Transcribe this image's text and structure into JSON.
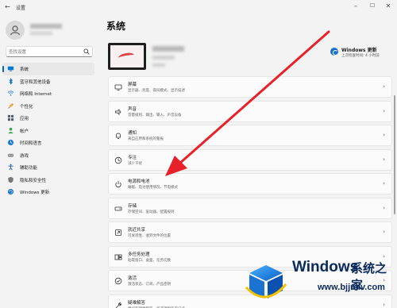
{
  "window": {
    "title": "设置"
  },
  "search": {
    "placeholder": "查找设置"
  },
  "nav": [
    {
      "label": "系统",
      "icon": "monitor-icon",
      "color": "#0078d4",
      "active": true
    },
    {
      "label": "蓝牙和其他设备",
      "icon": "bluetooth-icon",
      "color": "#0067c0"
    },
    {
      "label": "网络和 Internet",
      "icon": "wifi-icon",
      "color": "#3a86d9"
    },
    {
      "label": "个性化",
      "icon": "brush-icon",
      "color": "#e8a33d"
    },
    {
      "label": "应用",
      "icon": "apps-icon",
      "color": "#4d5b70"
    },
    {
      "label": "帐户",
      "icon": "person-icon",
      "color": "#2ea84a"
    },
    {
      "label": "时间和语言",
      "icon": "globe-clock-icon",
      "color": "#1f7ad6"
    },
    {
      "label": "游戏",
      "icon": "gamepad-icon",
      "color": "#888888"
    },
    {
      "label": "辅助功能",
      "icon": "accessibility-icon",
      "color": "#1d5fa8"
    },
    {
      "label": "隐私和安全性",
      "icon": "shield-icon",
      "color": "#777777"
    },
    {
      "label": "Windows 更新",
      "icon": "update-icon",
      "color": "#1a73c8"
    }
  ],
  "main": {
    "title": "系统",
    "update": {
      "title": "Windows 更新",
      "subtitle": "上次检查时间: 4 小时前"
    },
    "cards": [
      {
        "title": "屏幕",
        "subtitle": "显示器、亮度、夜间模式、显示描述",
        "icon": "display-icon"
      },
      {
        "title": "声音",
        "subtitle": "音量级别、输出、输入、声音设备",
        "icon": "speaker-icon"
      },
      {
        "title": "通知",
        "subtitle": "来自应用和系统的警报",
        "icon": "bell-icon"
      },
      {
        "title": "专注",
        "subtitle": "减少干扰",
        "icon": "focus-icon"
      },
      {
        "title": "电源和电池",
        "subtitle": "睡眠、电池使用情况、节电模式",
        "icon": "power-icon"
      },
      {
        "title": "存储",
        "subtitle": "存储空间、驱动器、配置规则",
        "icon": "storage-icon"
      },
      {
        "title": "就近共享",
        "subtitle": "可发现性、收到文件的位置",
        "icon": "share-icon"
      },
      {
        "title": "多任务处理",
        "subtitle": "贴靠窗口、桌面、任务切换",
        "icon": "multitask-icon"
      },
      {
        "title": "激活",
        "subtitle": "激活状态、订阅、产品密钥",
        "icon": "check-circle-icon"
      },
      {
        "title": "疑难解答",
        "subtitle": "建议的疑难解答、首选项和历史记录",
        "icon": "wrench-icon"
      }
    ]
  },
  "watermark": {
    "brand": "Windows",
    "brand_cn": "系统之家",
    "url": "www.bjjmlv.com"
  },
  "colors": {
    "accent": "#0067c0",
    "arrow": "#e8202a"
  }
}
